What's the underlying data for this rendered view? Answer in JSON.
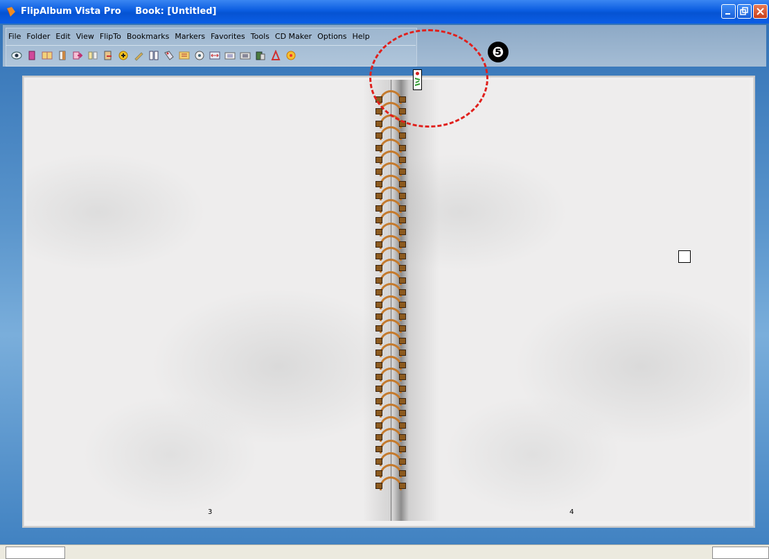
{
  "window": {
    "app_name": "FlipAlbum Vista Pro",
    "book_title": "Book: [Untitled]"
  },
  "menu": {
    "items": [
      "File",
      "Folder",
      "Edit",
      "View",
      "FlipTo",
      "Bookmarks",
      "Markers",
      "Favorites",
      "Tools",
      "CD Maker",
      "Options",
      "Help"
    ]
  },
  "toolbar": {
    "icons": [
      "eye-icon",
      "pink-book-icon",
      "open-book-icon",
      "single-page-icon",
      "next-arrow-icon",
      "two-pages-icon",
      "export-page-icon",
      "add-icon",
      "pencil-icon",
      "columns-icon",
      "tag-icon",
      "contents-icon",
      "music-icon",
      "resize-icon",
      "slide-icon",
      "filmstrip-icon",
      "stamp-icon",
      "pdf-icon",
      "burn-disc-icon"
    ]
  },
  "book": {
    "left_page_number": "3",
    "right_page_number": "4",
    "ring_count": 33
  },
  "callout": {
    "number": "❺",
    "color": "#e0201c"
  }
}
